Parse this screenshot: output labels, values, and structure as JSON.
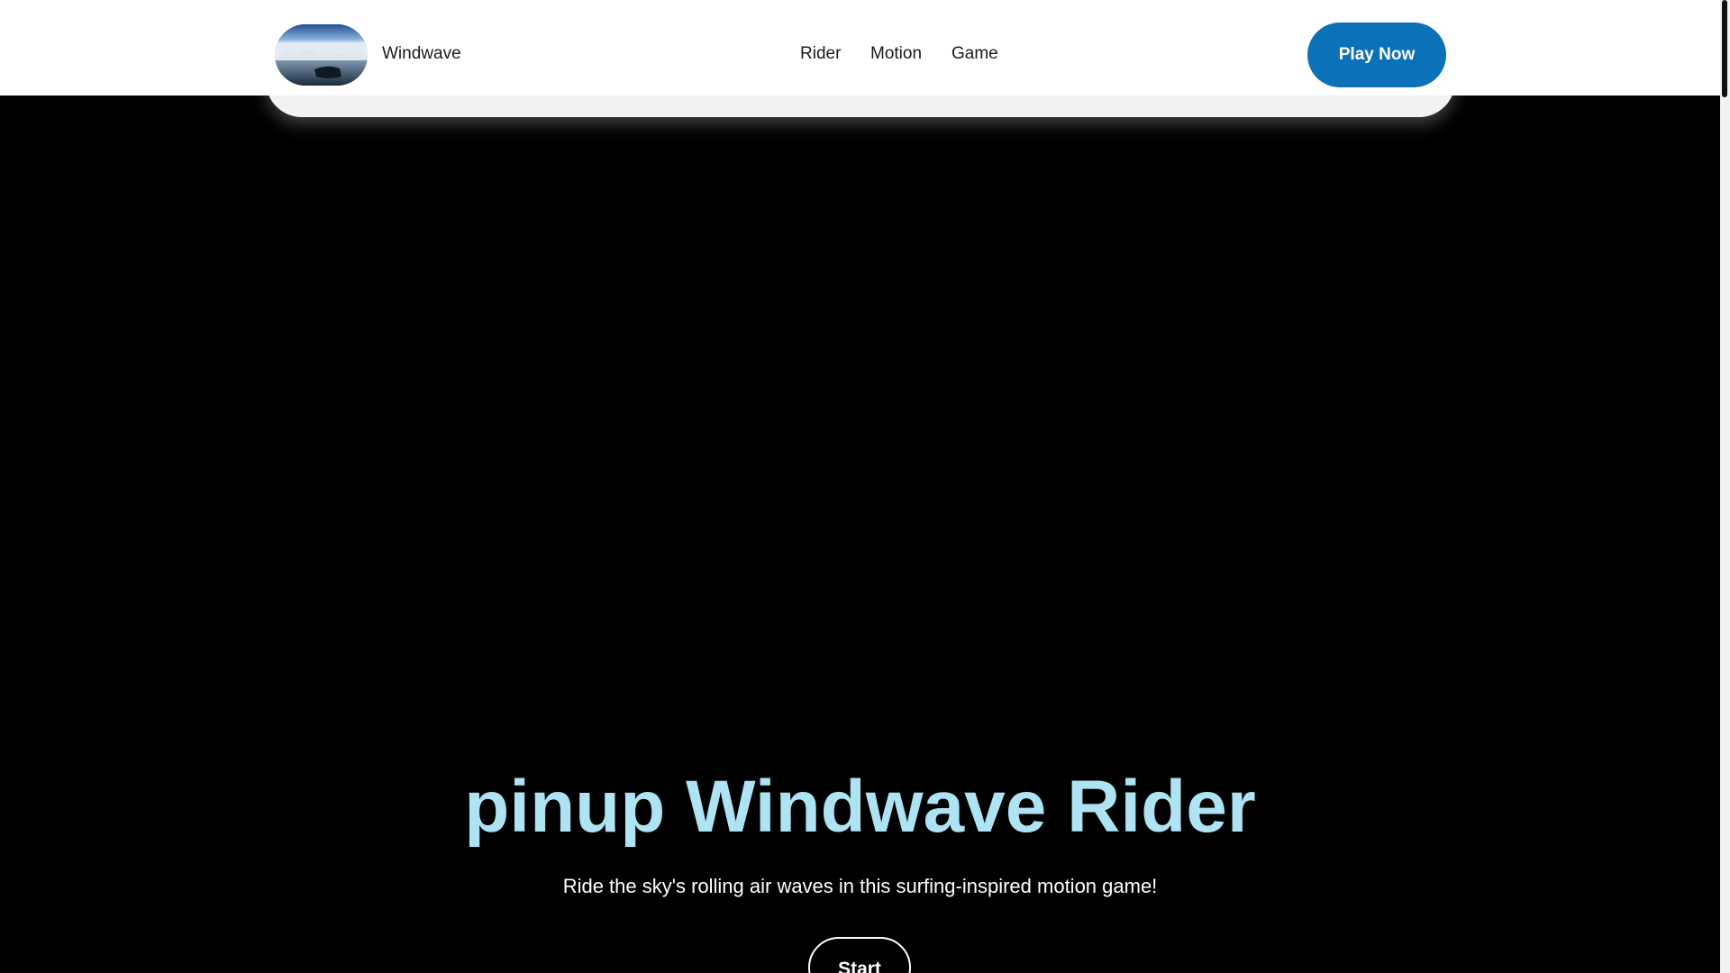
{
  "header": {
    "logo_icon": "landscape-lake-icon",
    "brand": "Windwave",
    "nav": [
      {
        "label": "Rider"
      },
      {
        "label": "Motion"
      },
      {
        "label": "Game"
      }
    ],
    "cta_label": "Play Now",
    "cta_color": "#0b72b9"
  },
  "hero": {
    "title": "pinup Windwave Rider",
    "subtitle": "Ride the sky's rolling air waves in this surfing-inspired motion game!",
    "start_label": "Start",
    "title_color": "#aee3f3"
  }
}
